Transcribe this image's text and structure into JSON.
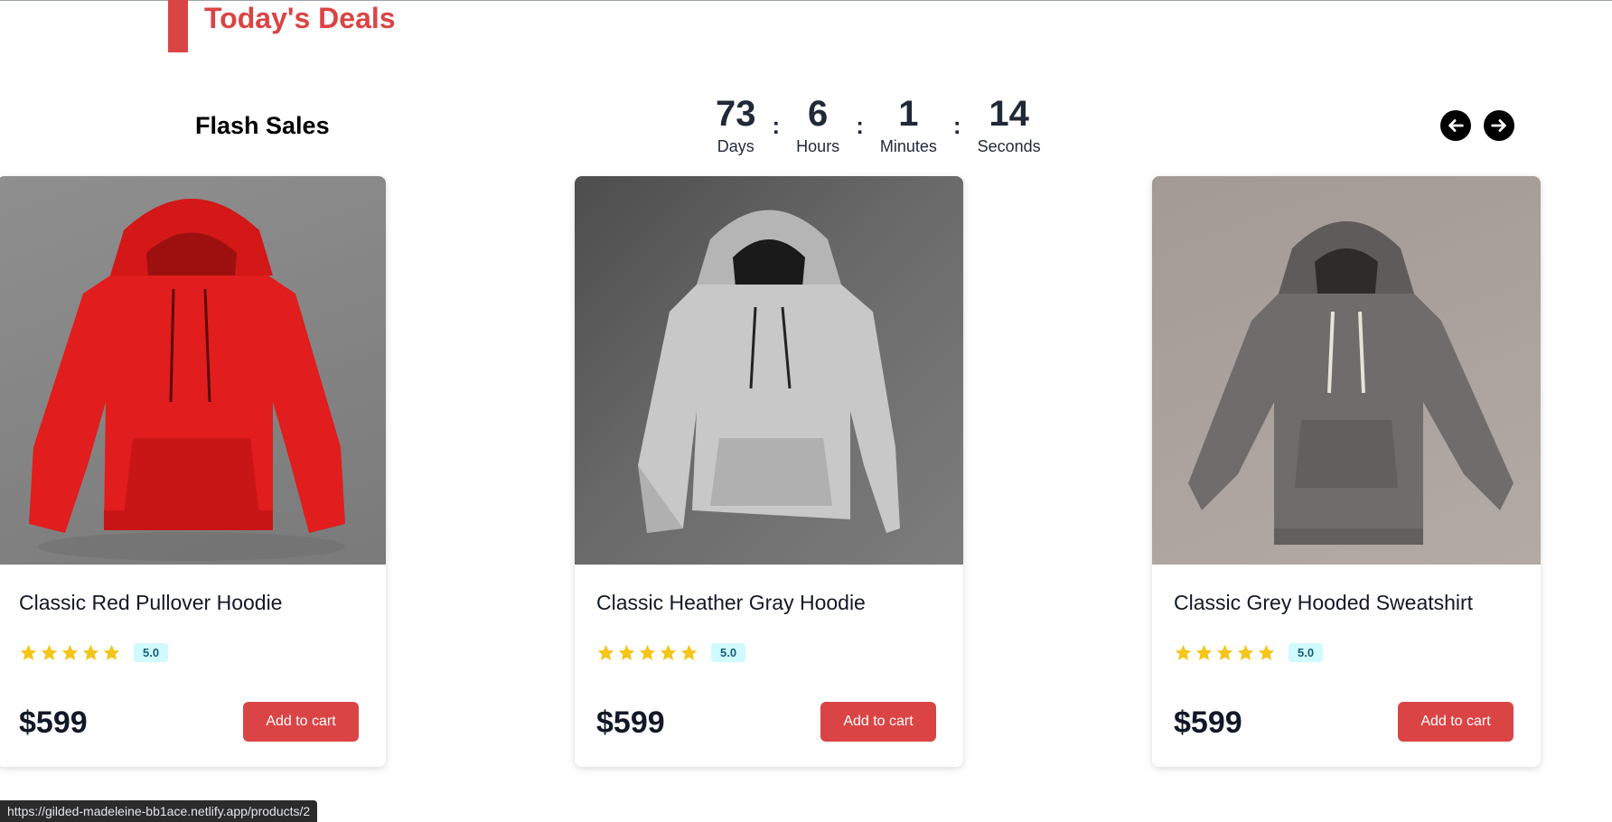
{
  "header": {
    "title": "Today's Deals",
    "accent_color": "#db4444"
  },
  "flash": {
    "title": "Flash Sales",
    "timer": [
      {
        "value": "73",
        "label": "Days"
      },
      {
        "value": "6",
        "label": "Hours"
      },
      {
        "value": "1",
        "label": "Minutes"
      },
      {
        "value": "14",
        "label": "Seconds"
      }
    ],
    "separator": ":",
    "nav": {
      "prev_icon": "arrow-left-circle-icon",
      "next_icon": "arrow-right-circle-icon"
    }
  },
  "products": [
    {
      "name": "Classic Red Pullover Hoodie",
      "rating": "5.0",
      "stars": 5,
      "price": "$599",
      "cart_label": "Add to cart",
      "hoodie_color": "#e11d1d"
    },
    {
      "name": "Classic Heather Gray Hoodie",
      "rating": "5.0",
      "stars": 5,
      "price": "$599",
      "cart_label": "Add to cart",
      "hoodie_color": "#c8c8c8"
    },
    {
      "name": "Classic Grey Hooded Sweatshirt",
      "rating": "5.0",
      "stars": 5,
      "price": "$599",
      "cart_label": "Add to cart",
      "hoodie_color": "#6f6c6b"
    }
  ],
  "status_bar": {
    "url": "https://gilded-madeleine-bb1ace.netlify.app/products/2"
  },
  "colors": {
    "star": "#f5c518",
    "badge_bg": "#cffafe"
  }
}
